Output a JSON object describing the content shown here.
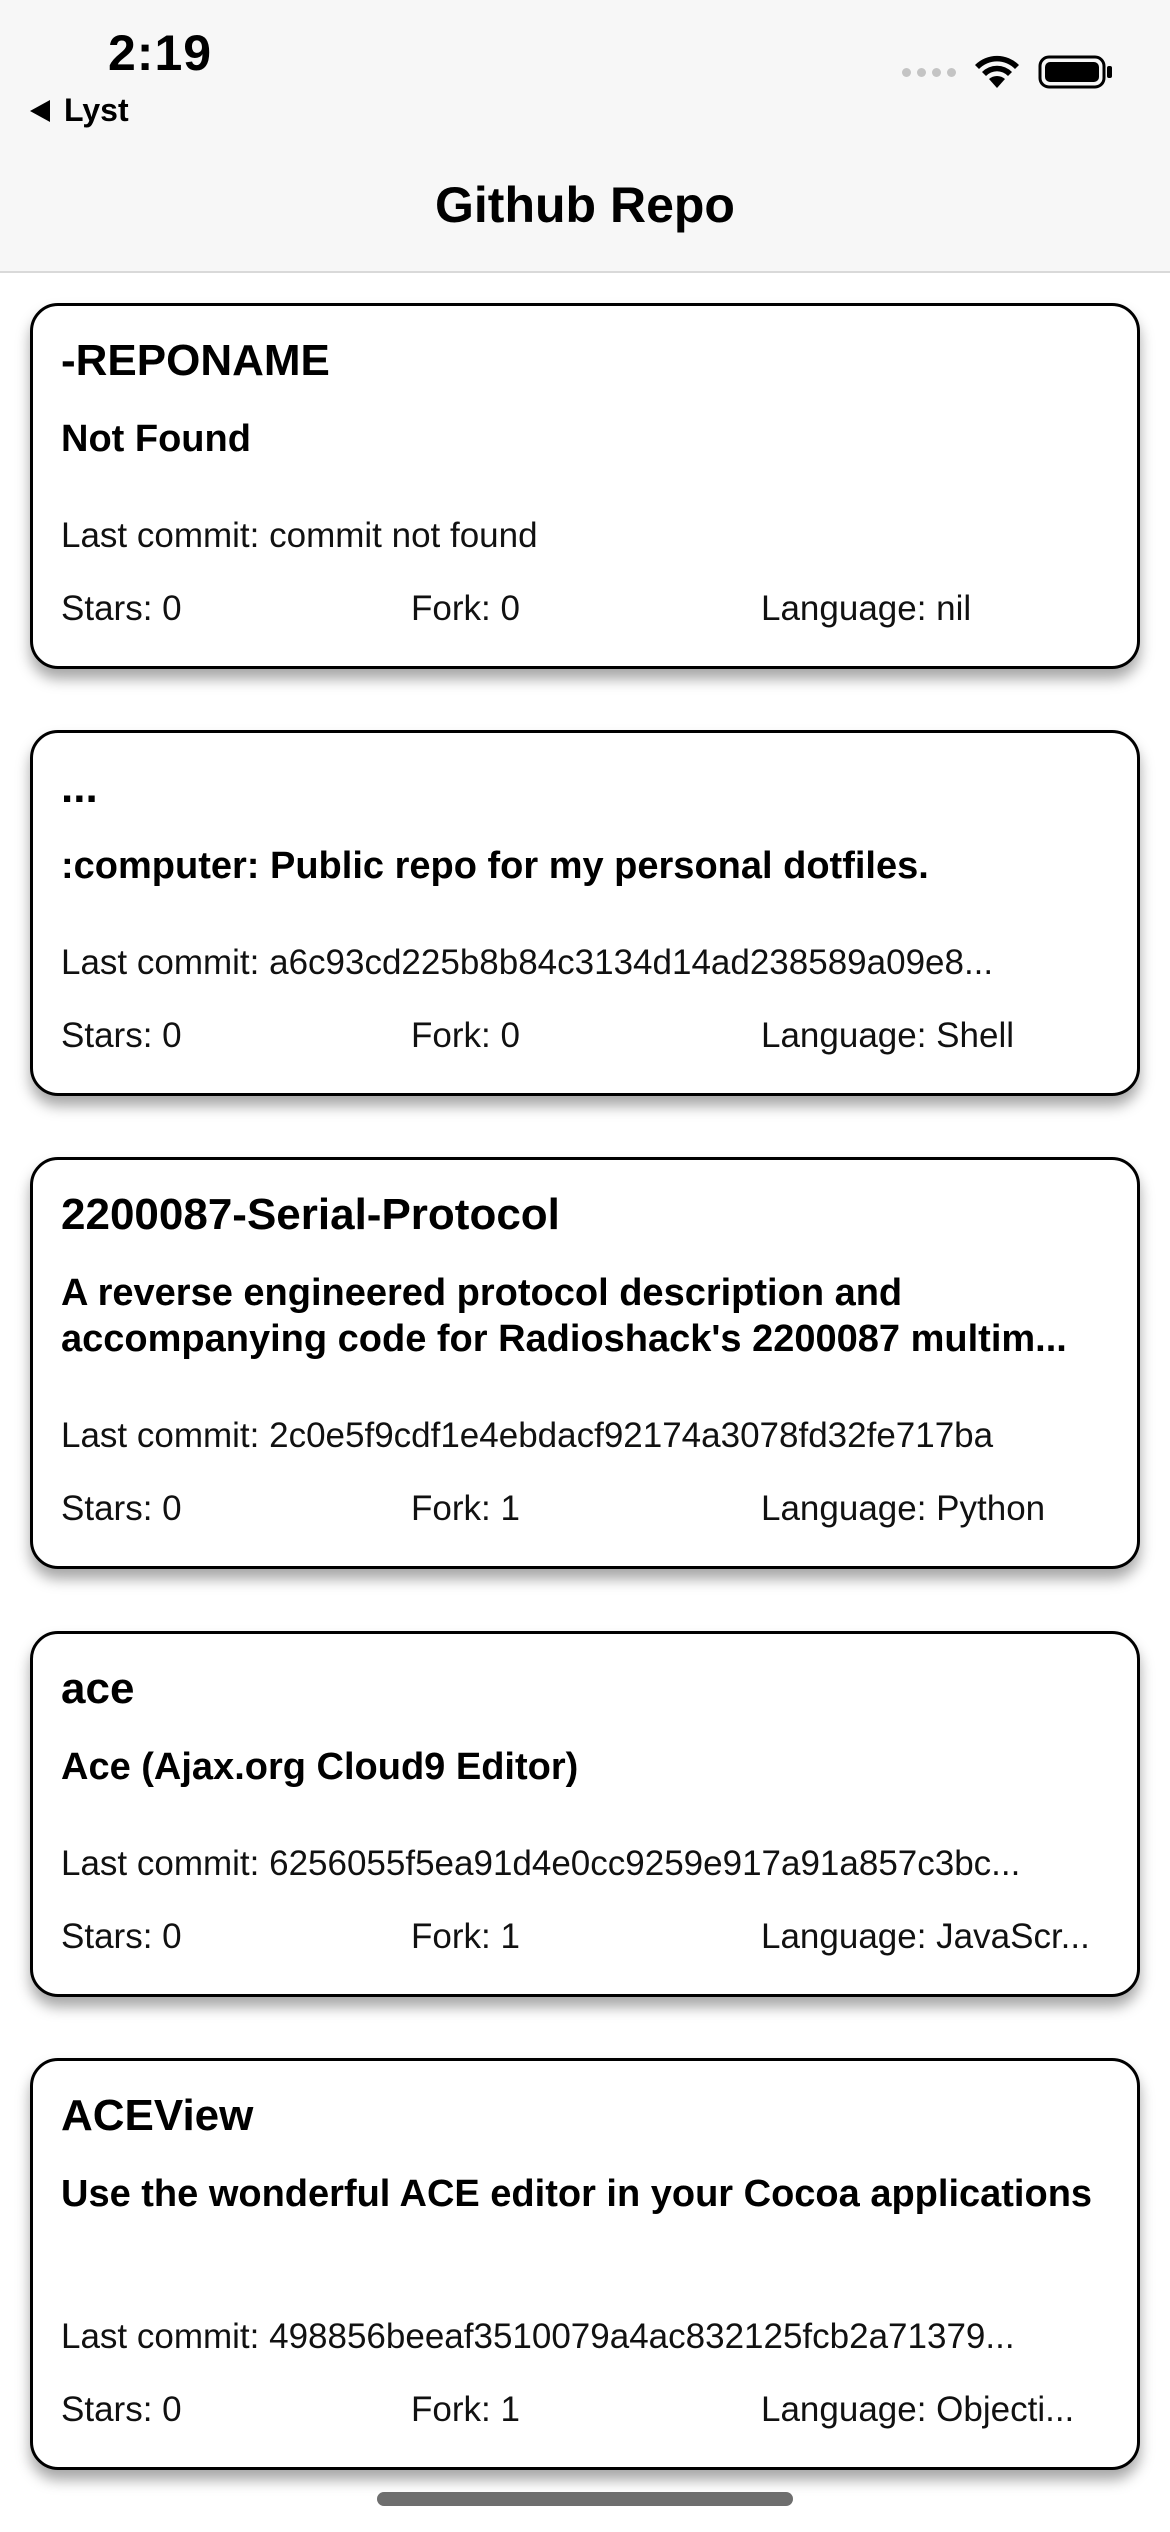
{
  "status_bar": {
    "time": "2:19",
    "back_label": "Lyst"
  },
  "nav": {
    "title": "Github Repo"
  },
  "repos": [
    {
      "name": "-REPONAME",
      "description": "Not Found",
      "commit": "Last commit: commit not found",
      "stars": "Stars: 0",
      "fork": "Fork: 0",
      "language": "Language: nil"
    },
    {
      "name": "...",
      "description": ":computer: Public repo for my personal dotfiles.",
      "commit": "Last commit: a6c93cd225b8b84c3134d14ad238589a09e8...",
      "stars": "Stars: 0",
      "fork": "Fork: 0",
      "language": "Language: Shell"
    },
    {
      "name": "2200087-Serial-Protocol",
      "description": "A reverse engineered protocol description and accompanying code for Radioshack's 2200087 multim...",
      "commit": "Last commit: 2c0e5f9cdf1e4ebdacf92174a3078fd32fe717ba",
      "stars": "Stars: 0",
      "fork": "Fork: 1",
      "language": "Language: Python"
    },
    {
      "name": "ace",
      "description": "Ace (Ajax.org Cloud9 Editor)",
      "commit": "Last commit: 6256055f5ea91d4e0cc9259e917a91a857c3bc...",
      "stars": "Stars: 0",
      "fork": "Fork: 1",
      "language": "Language: JavaScr..."
    },
    {
      "name": "ACEView",
      "description": "Use the wonderful ACE editor in your Cocoa applications",
      "commit": "Last commit: 498856beeaf3510079a4ac832125fcb2a71379...",
      "stars": "Stars: 0",
      "fork": "Fork: 1",
      "language": "Language: Objecti..."
    }
  ]
}
